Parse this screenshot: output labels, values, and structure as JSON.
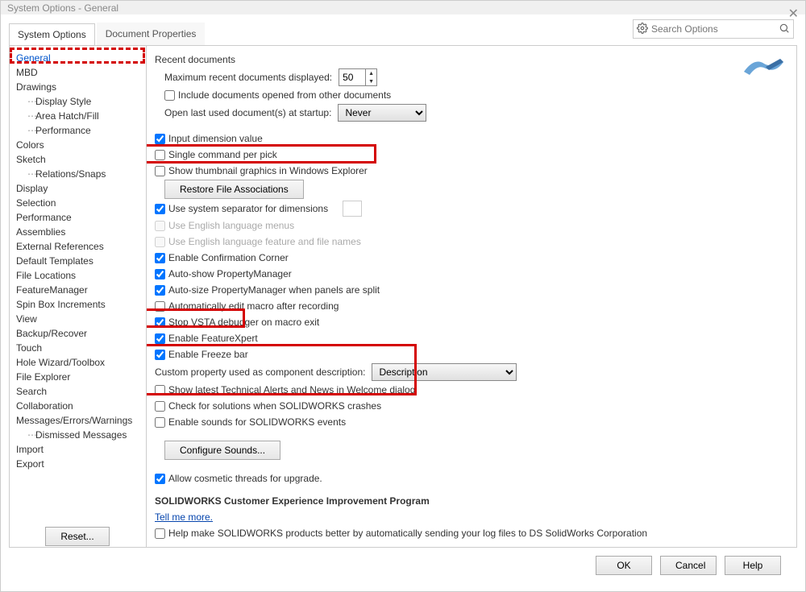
{
  "window": {
    "title": "System Options - General"
  },
  "tabs": {
    "system_options": "System Options",
    "document_properties": "Document Properties"
  },
  "search": {
    "placeholder": "Search Options"
  },
  "sidebar": {
    "reset": "Reset...",
    "items": [
      {
        "label": "General",
        "selected": true
      },
      {
        "label": "MBD"
      },
      {
        "label": "Drawings"
      },
      {
        "label": "Display Style",
        "sub": true
      },
      {
        "label": "Area Hatch/Fill",
        "sub": true
      },
      {
        "label": "Performance",
        "sub": true
      },
      {
        "label": "Colors"
      },
      {
        "label": "Sketch"
      },
      {
        "label": "Relations/Snaps",
        "sub": true
      },
      {
        "label": "Display"
      },
      {
        "label": "Selection"
      },
      {
        "label": "Performance"
      },
      {
        "label": "Assemblies"
      },
      {
        "label": "External References"
      },
      {
        "label": "Default Templates"
      },
      {
        "label": "File Locations"
      },
      {
        "label": "FeatureManager"
      },
      {
        "label": "Spin Box Increments"
      },
      {
        "label": "View"
      },
      {
        "label": "Backup/Recover"
      },
      {
        "label": "Touch"
      },
      {
        "label": "Hole Wizard/Toolbox"
      },
      {
        "label": "File Explorer"
      },
      {
        "label": "Search"
      },
      {
        "label": "Collaboration"
      },
      {
        "label": "Messages/Errors/Warnings"
      },
      {
        "label": "Dismissed Messages",
        "sub": true
      },
      {
        "label": "Import"
      },
      {
        "label": "Export"
      }
    ]
  },
  "panel": {
    "recent_docs_header": "Recent documents",
    "max_recent_label": "Maximum recent documents displayed:",
    "max_recent_value": "50",
    "include_from_other": "Include documents opened from other documents",
    "open_last_label": "Open last used document(s) at startup:",
    "open_last_value": "Never",
    "input_dim": "Input dimension value",
    "single_cmd": "Single command per pick",
    "show_thumb": "Show thumbnail graphics in Windows Explorer",
    "restore_btn": "Restore File Associations",
    "use_sys_sep": "Use system separator for dimensions",
    "use_eng_menus": "Use English language menus",
    "use_eng_files": "Use English language feature and file names",
    "enable_confirm": "Enable Confirmation Corner",
    "auto_show_pm": "Auto-show PropertyManager",
    "auto_size_pm": "Auto-size PropertyManager when panels are split",
    "auto_edit_macro": "Automatically edit macro after recording",
    "stop_vsta": "Stop VSTA debugger on macro exit",
    "enable_fx": "Enable FeatureXpert",
    "enable_freeze": "Enable Freeze bar",
    "custom_prop_label": "Custom property used as component description:",
    "custom_prop_value": "Description",
    "show_alerts": "Show latest Technical Alerts and News in Welcome dialog",
    "check_solutions": "Check for solutions when SOLIDWORKS crashes",
    "enable_sounds": "Enable sounds for SOLIDWORKS events",
    "configure_sounds_btn": "Configure Sounds...",
    "allow_cosmetic": "Allow cosmetic threads for upgrade.",
    "ceip_header": "SOLIDWORKS Customer Experience Improvement Program",
    "tell_me_more": "Tell me more.",
    "help_make": "Help make SOLIDWORKS products better by automatically sending your log files to DS SolidWorks Corporation"
  },
  "footer": {
    "ok": "OK",
    "cancel": "Cancel",
    "help": "Help"
  }
}
